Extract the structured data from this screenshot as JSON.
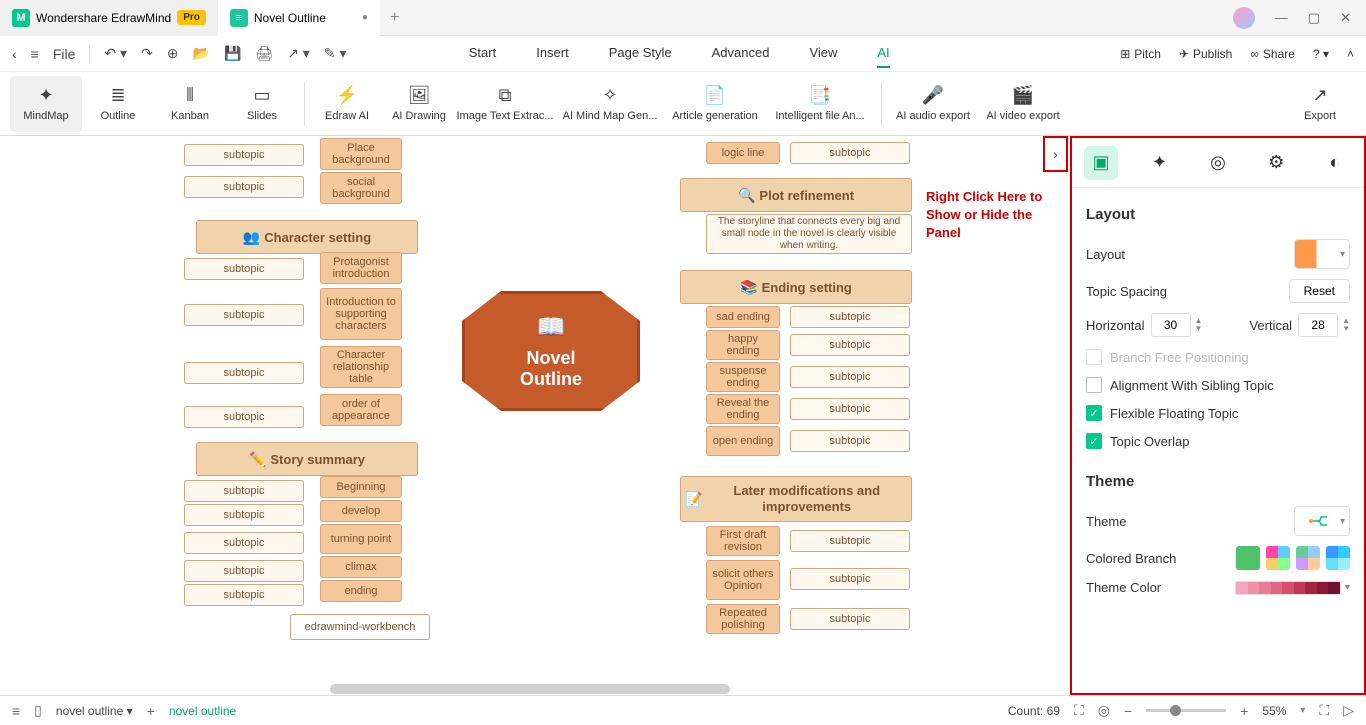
{
  "titlebar": {
    "app_name": "Wondershare EdrawMind",
    "pro_badge": "Pro",
    "doc_tab": "Novel Outline",
    "modified_dot": "●"
  },
  "quickbar": {
    "file_label": "File"
  },
  "menu": {
    "start": "Start",
    "insert": "Insert",
    "page_style": "Page Style",
    "advanced": "Advanced",
    "view": "View",
    "ai": "AI"
  },
  "topactions": {
    "pitch": "Pitch",
    "publish": "Publish",
    "share": "Share"
  },
  "toolbar": {
    "mindmap": "MindMap",
    "outline": "Outline",
    "kanban": "Kanban",
    "slides": "Slides",
    "edraw_ai": "Edraw AI",
    "ai_drawing": "AI Drawing",
    "image_text": "Image Text Extrac...",
    "ai_mindmap": "AI Mind Map Gen...",
    "article": "Article generation",
    "file_an": "Intelligent file An...",
    "audio": "AI audio export",
    "video": "AI video export",
    "export": "Export"
  },
  "annotation": "Right Click Here to Show or Hide the Panel",
  "center": {
    "line1": "Novel",
    "line2": "Outline"
  },
  "nodes": {
    "s1": "subtopic",
    "place_bg": "Place background",
    "social_bg": "social background",
    "character_setting": "Character setting",
    "protag": "Protagonist introduction",
    "supporting": "Introduction to supporting characters",
    "reltable": "Character relationship table",
    "appearance": "order of appearance",
    "story_summary": "Story summary",
    "beginning": "Beginning",
    "develop": "develop",
    "turning": "turning point",
    "climax": "climax",
    "ending": "ending",
    "workbench": "edrawmind-workbench",
    "logic_line": "logic line",
    "plot_refine": "Plot refinement",
    "plot_desc": "The storyline that connects every big and small node in the novel is clearly visible when writing.",
    "ending_setting": "Ending setting",
    "sad": "sad ending",
    "happy": "happy ending",
    "suspense": "suspense ending",
    "reveal": "Reveal the ending",
    "open": "open ending",
    "later": "Later modifications and improvements",
    "firstdraft": "First draft revision",
    "solicit": "solicit others Opinion",
    "repeated": "Repeated polishing"
  },
  "panel": {
    "layout_h": "Layout",
    "layout_label": "Layout",
    "spacing_label": "Topic Spacing",
    "reset": "Reset",
    "horizontal": "Horizontal",
    "vertical": "Vertical",
    "h_val": "30",
    "v_val": "28",
    "branch_free": "Branch Free Positioning",
    "align_sibling": "Alignment With Sibling Topic",
    "flex_float": "Flexible Floating Topic",
    "overlap": "Topic Overlap",
    "theme_h": "Theme",
    "theme_label": "Theme",
    "colored_branch": "Colored Branch",
    "theme_color": "Theme Color"
  },
  "status": {
    "crumb1": "novel outline",
    "crumb2": "novel outline",
    "count_label": "Count:",
    "count_val": "69",
    "zoom": "55%"
  }
}
